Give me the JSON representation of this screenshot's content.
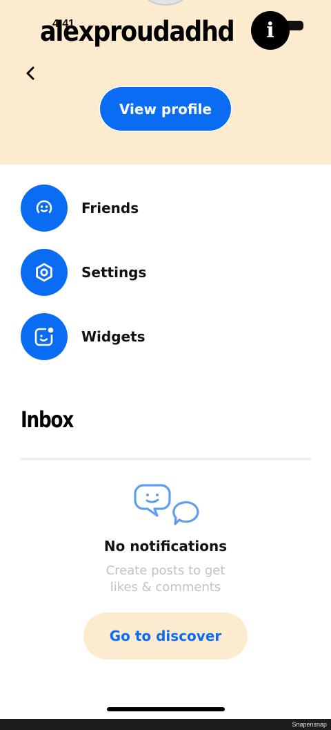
{
  "status_bar": {
    "time": "4:41"
  },
  "header": {
    "username": "alexproudadhd",
    "info_glyph": "i",
    "view_profile_label": "View profile",
    "background_color": "#fdebd0"
  },
  "menu": {
    "items": [
      {
        "label": "Friends",
        "icon": "smiley-face-icon"
      },
      {
        "label": "Settings",
        "icon": "hexagon-nut-icon"
      },
      {
        "label": "Widgets",
        "icon": "widget-smile-dot-icon"
      }
    ]
  },
  "inbox": {
    "title": "Inbox",
    "empty_title": "No notifications",
    "empty_line1": "Create posts to get",
    "empty_line2": "likes & comments",
    "discover_label": "Go to discover",
    "icon": "chat-bubbles-icon"
  },
  "footer": {
    "watermark": "Snapensnap"
  },
  "colors": {
    "accent": "#0a6cf2",
    "header_bg": "#fdebd0",
    "muted_text": "#c2c2c2"
  }
}
